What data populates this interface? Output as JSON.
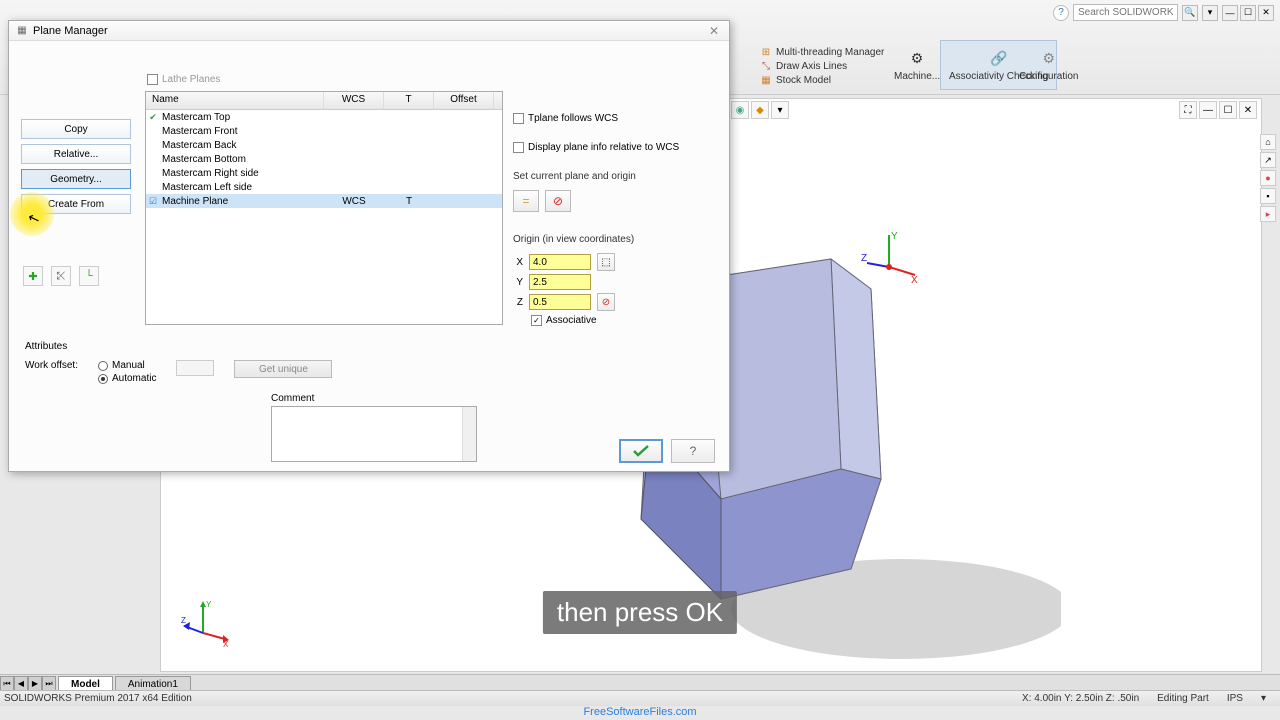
{
  "top": {
    "search_placeholder": "Search SOLIDWORKS Help"
  },
  "ribbon": {
    "small": [
      {
        "icon": "⊞",
        "label": "Multi-threading Manager"
      },
      {
        "icon": "⤡",
        "label": "Draw Axis Lines"
      },
      {
        "icon": "▦",
        "label": "Stock Model"
      }
    ],
    "machine": "Machine...",
    "assoc": "Associativity Checking",
    "config": "Configuration"
  },
  "dialog": {
    "title": "Plane Manager",
    "lathe": "Lathe Planes",
    "sidebar": [
      "Copy",
      "Relative...",
      "Geometry...",
      "Create From"
    ],
    "table": {
      "headers": {
        "name": "Name",
        "wcs": "WCS",
        "t": "T",
        "offset": "Offset"
      },
      "rows": [
        {
          "chk": "green",
          "name": "Mastercam Top",
          "wcs": "",
          "t": "",
          "off": ""
        },
        {
          "chk": "",
          "name": "Mastercam Front",
          "wcs": "",
          "t": "",
          "off": ""
        },
        {
          "chk": "",
          "name": "Mastercam Back",
          "wcs": "",
          "t": "",
          "off": ""
        },
        {
          "chk": "",
          "name": "Mastercam Bottom",
          "wcs": "",
          "t": "",
          "off": ""
        },
        {
          "chk": "",
          "name": "Mastercam Right side",
          "wcs": "",
          "t": "",
          "off": ""
        },
        {
          "chk": "",
          "name": "Mastercam Left side",
          "wcs": "",
          "t": "",
          "off": ""
        },
        {
          "chk": "blue",
          "name": "Machine Plane",
          "wcs": "WCS",
          "t": "T",
          "off": "",
          "sel": true
        }
      ]
    },
    "right": {
      "tplane": "Tplane follows WCS",
      "display": "Display plane info relative to WCS",
      "set_current": "Set current plane and origin",
      "origin": "Origin (in view coordinates)",
      "x": "4.0",
      "y": "2.5",
      "z": "0.5",
      "assoc": "Associative"
    },
    "attr": {
      "title": "Attributes",
      "workoffset": "Work offset:",
      "manual": "Manual",
      "automatic": "Automatic",
      "getunique": "Get unique",
      "comment": "Comment"
    }
  },
  "tabs": {
    "model": "Model",
    "anim": "Animation1"
  },
  "status": {
    "left": "SOLIDWORKS Premium 2017 x64 Edition",
    "coords": "X: 4.00in Y: 2.50in Z: .50in",
    "mode": "Editing Part",
    "units": "IPS"
  },
  "subtitle": "then press OK",
  "watermark": "FreeSoftwareFiles.com"
}
